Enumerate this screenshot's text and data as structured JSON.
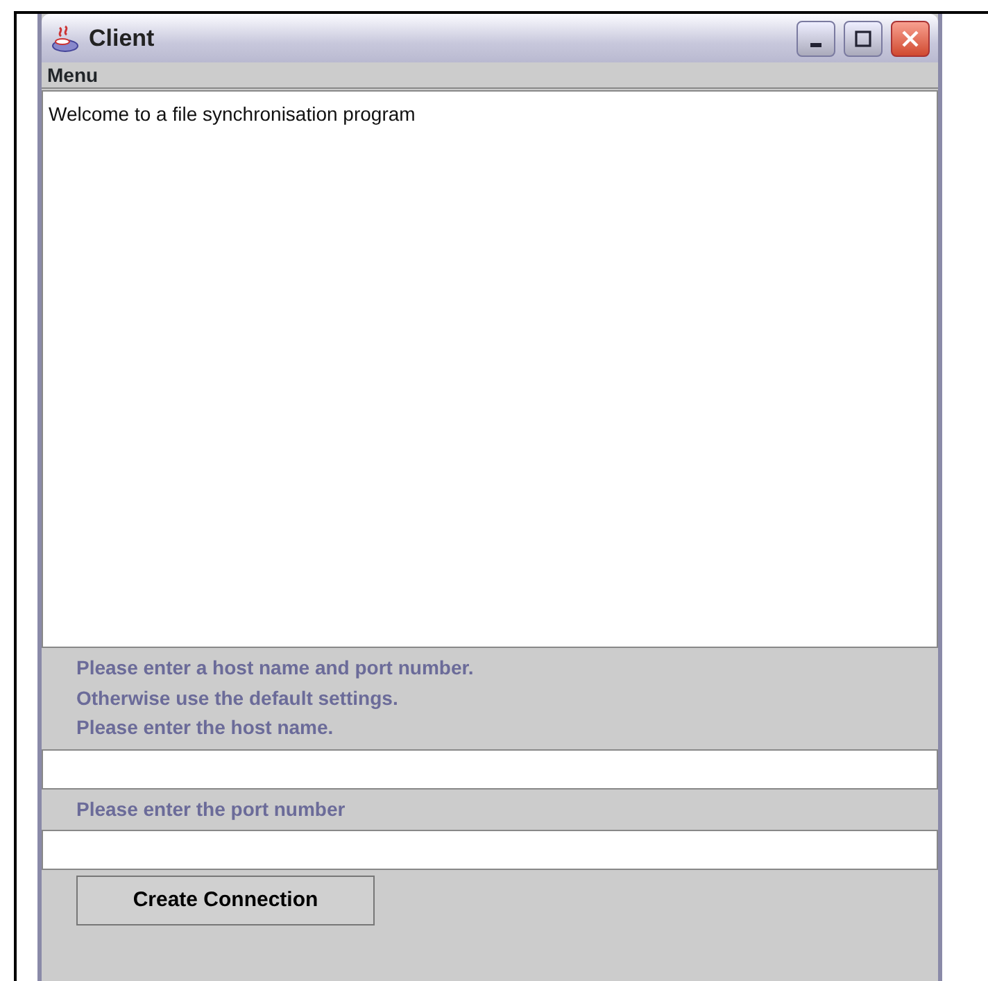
{
  "window": {
    "title": "Client"
  },
  "menu_bar": {
    "items": [
      "Menu"
    ]
  },
  "output_area": {
    "text": "Welcome to a file synchronisation program"
  },
  "instructions": [
    "Please enter a host name and port number.",
    "Otherwise use the default settings.",
    "Please enter the host name."
  ],
  "port_label": "Please enter the port number",
  "buttons": [
    "Create Connection"
  ]
}
